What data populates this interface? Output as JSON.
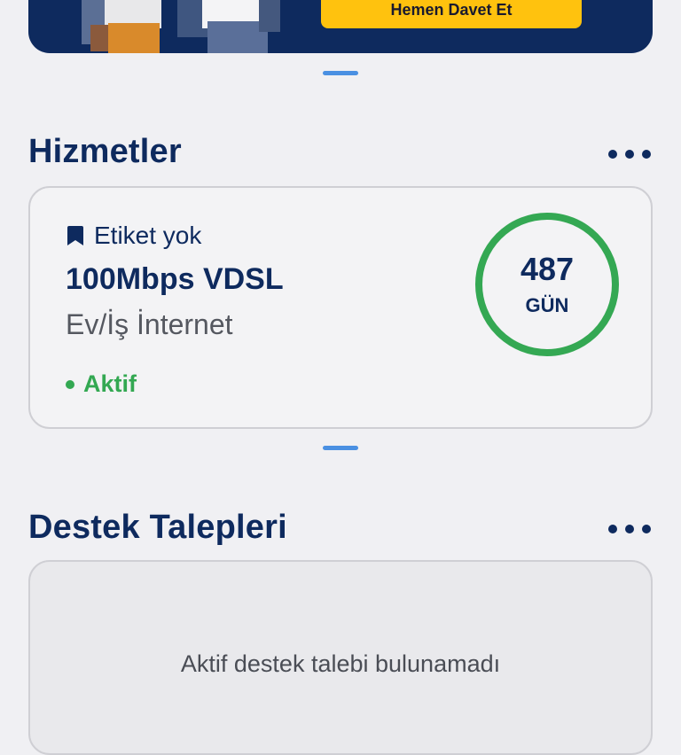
{
  "banner": {
    "cta_label": "Hemen Davet Et"
  },
  "services": {
    "title": "Hizmetler",
    "card": {
      "tag_label": "Etiket yok",
      "name": "100Mbps VDSL",
      "type": "Ev/İş İnternet",
      "status": "Aktif",
      "days_value": "487",
      "days_unit": "GÜN"
    }
  },
  "support": {
    "title": "Destek Talepleri",
    "empty_message": "Aktif destek talebi bulunamadı"
  },
  "colors": {
    "primary": "#0e2a5e",
    "accent_yellow": "#ffc20e",
    "active_green": "#34a853",
    "pager_blue": "#4a90e2"
  }
}
